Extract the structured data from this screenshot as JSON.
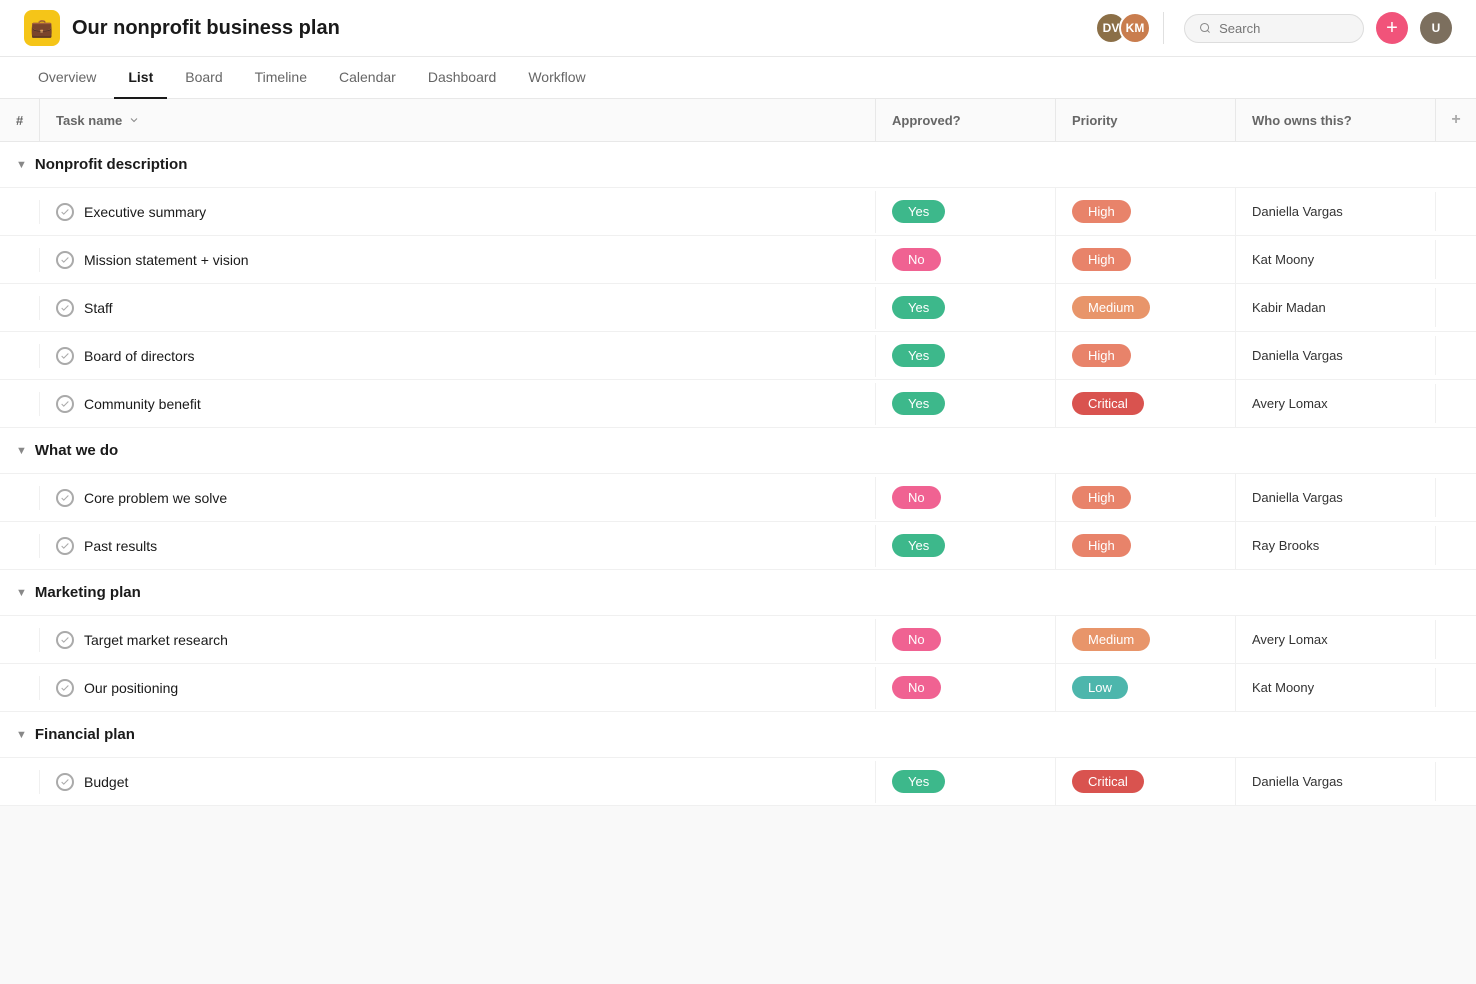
{
  "app": {
    "icon": "💼",
    "title": "Our nonprofit business plan"
  },
  "header": {
    "search_placeholder": "Search",
    "add_label": "+",
    "avatars": [
      {
        "initials": "DV",
        "class": "a1"
      },
      {
        "initials": "KM",
        "class": "a2"
      }
    ]
  },
  "nav": {
    "tabs": [
      {
        "label": "Overview",
        "active": false
      },
      {
        "label": "List",
        "active": true
      },
      {
        "label": "Board",
        "active": false
      },
      {
        "label": "Timeline",
        "active": false
      },
      {
        "label": "Calendar",
        "active": false
      },
      {
        "label": "Dashboard",
        "active": false
      },
      {
        "label": "Workflow",
        "active": false
      }
    ]
  },
  "table": {
    "columns": {
      "number": "#",
      "task": "Task name",
      "approved": "Approved?",
      "priority": "Priority",
      "owner": "Who owns this?"
    },
    "sections": [
      {
        "id": "nonprofit-description",
        "label": "Nonprofit description",
        "rows": [
          {
            "task": "Executive summary",
            "approved": "Yes",
            "approved_class": "badge-yes",
            "priority": "High",
            "priority_class": "badge-high",
            "owner": "Daniella Vargas"
          },
          {
            "task": "Mission statement + vision",
            "approved": "No",
            "approved_class": "badge-no",
            "priority": "High",
            "priority_class": "badge-high",
            "owner": "Kat Moony"
          },
          {
            "task": "Staff",
            "approved": "Yes",
            "approved_class": "badge-yes",
            "priority": "Medium",
            "priority_class": "badge-medium",
            "owner": "Kabir Madan"
          },
          {
            "task": "Board of directors",
            "approved": "Yes",
            "approved_class": "badge-yes",
            "priority": "High",
            "priority_class": "badge-high",
            "owner": "Daniella Vargas"
          },
          {
            "task": "Community benefit",
            "approved": "Yes",
            "approved_class": "badge-yes",
            "priority": "Critical",
            "priority_class": "badge-critical",
            "owner": "Avery Lomax"
          }
        ]
      },
      {
        "id": "what-we-do",
        "label": "What we do",
        "rows": [
          {
            "task": "Core problem we solve",
            "approved": "No",
            "approved_class": "badge-no",
            "priority": "High",
            "priority_class": "badge-high",
            "owner": "Daniella Vargas"
          },
          {
            "task": "Past results",
            "approved": "Yes",
            "approved_class": "badge-yes",
            "priority": "High",
            "priority_class": "badge-high",
            "owner": "Ray Brooks"
          }
        ]
      },
      {
        "id": "marketing-plan",
        "label": "Marketing plan",
        "rows": [
          {
            "task": "Target market research",
            "approved": "No",
            "approved_class": "badge-no",
            "priority": "Medium",
            "priority_class": "badge-medium",
            "owner": "Avery Lomax"
          },
          {
            "task": "Our positioning",
            "approved": "No",
            "approved_class": "badge-no",
            "priority": "Low",
            "priority_class": "badge-low",
            "owner": "Kat Moony"
          }
        ]
      },
      {
        "id": "financial-plan",
        "label": "Financial plan",
        "rows": [
          {
            "task": "Budget",
            "approved": "Yes",
            "approved_class": "badge-yes",
            "priority": "Critical",
            "priority_class": "badge-critical",
            "owner": "Daniella Vargas"
          }
        ]
      }
    ]
  }
}
